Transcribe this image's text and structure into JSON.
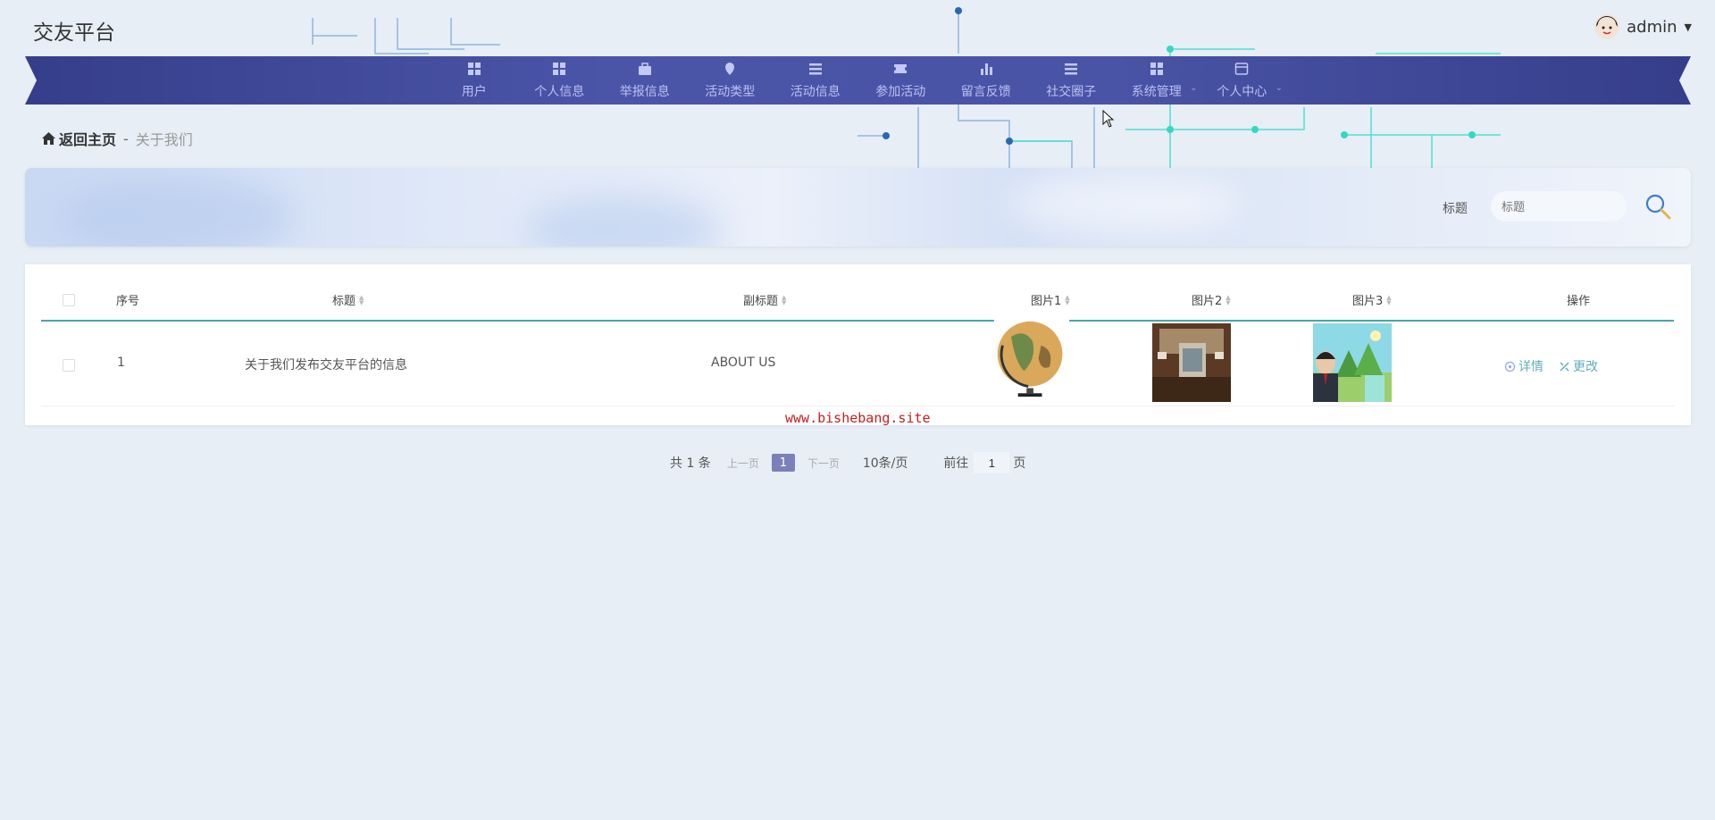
{
  "header": {
    "brand": "交友平台",
    "username": "admin"
  },
  "nav": [
    {
      "label": "用户",
      "icon": "grid-icon",
      "dropdown": false
    },
    {
      "label": "个人信息",
      "icon": "grid-icon",
      "dropdown": false
    },
    {
      "label": "举报信息",
      "icon": "briefcase-icon",
      "dropdown": false
    },
    {
      "label": "活动类型",
      "icon": "pin-icon",
      "dropdown": false
    },
    {
      "label": "活动信息",
      "icon": "list-icon",
      "dropdown": false
    },
    {
      "label": "参加活动",
      "icon": "ticket-icon",
      "dropdown": false
    },
    {
      "label": "留言反馈",
      "icon": "bar-chart-icon",
      "dropdown": false
    },
    {
      "label": "社交圈子",
      "icon": "list-icon",
      "dropdown": false
    },
    {
      "label": "系统管理",
      "icon": "grid-icon",
      "dropdown": true
    },
    {
      "label": "个人中心",
      "icon": "window-icon",
      "dropdown": true
    }
  ],
  "breadcrumb": {
    "home": "返回主页",
    "separator": "-",
    "current": "关于我们"
  },
  "search": {
    "label": "标题",
    "placeholder": "标题"
  },
  "table": {
    "columns": [
      "序号",
      "标题",
      "副标题",
      "图片1",
      "图片2",
      "图片3",
      "操作"
    ],
    "rows": [
      {
        "index": "1",
        "title": "关于我们发布交友平台的信息",
        "subtitle": "ABOUT US",
        "actions": [
          "详情",
          "更改"
        ]
      }
    ]
  },
  "watermark": "www.bishebang.site",
  "pagination": {
    "total": "共 1 条",
    "prev": "上一页",
    "current": "1",
    "next": "下一页",
    "page_size": "10条/页",
    "goto": "前往",
    "goto_value": "1",
    "page_unit": "页"
  },
  "colors": {
    "nav_bg": "#4a54a6",
    "nav_text": "#b9c0f0",
    "accent": "#4aa6a8",
    "action": "#5fb0b6",
    "page_active": "#7b80b8",
    "watermark": "#c81e1e"
  }
}
